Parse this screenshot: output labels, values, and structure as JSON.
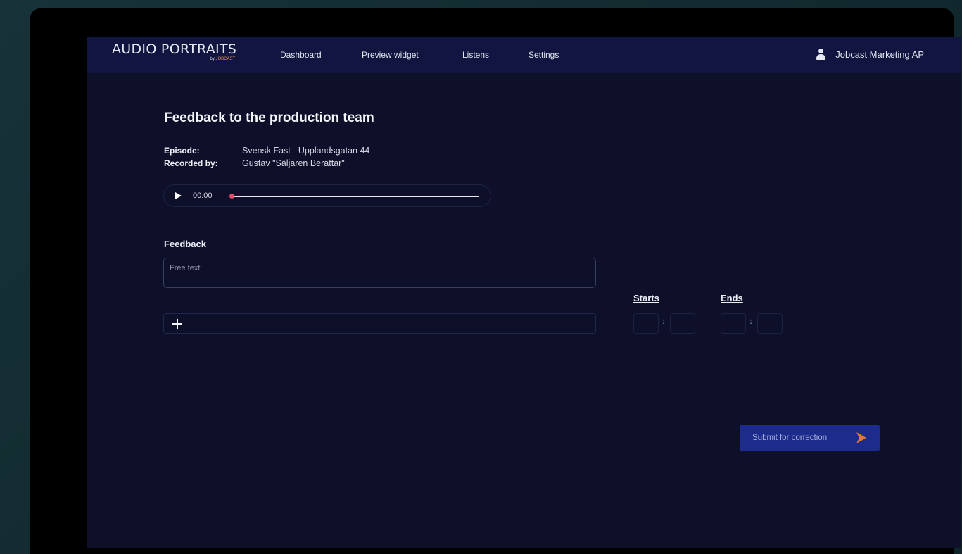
{
  "app": {
    "logo_main": "AUDIO PORTRAITS",
    "logo_by": "by",
    "logo_brand": "JOBCAST"
  },
  "nav": {
    "items": [
      {
        "label": "Dashboard"
      },
      {
        "label": "Preview widget"
      },
      {
        "label": "Listens"
      },
      {
        "label": "Settings"
      }
    ]
  },
  "user": {
    "name": "Jobcast Marketing AP",
    "icon": "user-icon"
  },
  "page": {
    "title": "Feedback to the production team",
    "episode_label": "Episode:",
    "episode_value": "Svensk Fast - Upplandsgatan 44",
    "recorded_label": "Recorded by:",
    "recorded_value": "Gustav \"Säljaren Berättar\""
  },
  "player": {
    "time": "00:00",
    "progress": 0
  },
  "feedback": {
    "label": "Feedback",
    "placeholder": "Free text",
    "value": ""
  },
  "timing": {
    "starts_label": "Starts",
    "ends_label": "Ends",
    "separator": ":"
  },
  "submit": {
    "label": "Submit for correction"
  },
  "colors": {
    "background": "#0e1029",
    "topbar": "#111540",
    "accent": "#1c2b8c",
    "arrow": "#e07a2e",
    "thumb": "#e8496b"
  }
}
